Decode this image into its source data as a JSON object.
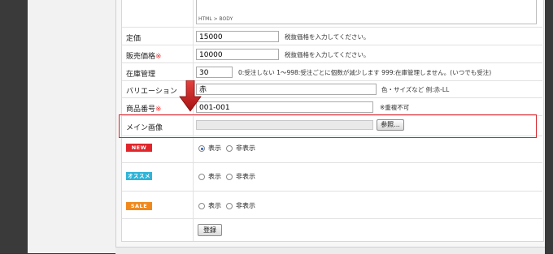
{
  "editor": {
    "path": "HTML > BODY"
  },
  "fields": {
    "price": {
      "label": "定価",
      "value": "15000",
      "hint": "税抜価格を入力してください。"
    },
    "sale_price": {
      "label": "販売価格",
      "req": "※",
      "value": "10000",
      "hint": "税抜価格を入力してください。"
    },
    "stock": {
      "label": "在庫管理",
      "value": "30",
      "hint": "0:受注しない  1〜998:受注ごとに個数が減少します  999:在庫管理しません。(いつでも受注)"
    },
    "variation": {
      "label": "バリエーション",
      "value": "赤",
      "hint": "色・サイズなど  例:赤-LL"
    },
    "product_no": {
      "label": "商品番号",
      "req": "※",
      "value": "001-001",
      "hint": "※重複不可"
    },
    "main_image": {
      "label": "メイン画像",
      "browse": "参照..."
    }
  },
  "badges": [
    {
      "text": "NEW",
      "color": "#e0262b",
      "options": [
        "表示",
        "非表示"
      ],
      "selected": 0
    },
    {
      "text": "オススメ",
      "color": "#2fb4d8",
      "options": [
        "表示",
        "非表示"
      ],
      "selected": -1
    },
    {
      "text": "SALE",
      "color": "#f0891d",
      "options": [
        "表示",
        "非表示"
      ],
      "selected": -1
    }
  ],
  "submit": "登録",
  "colors": {
    "highlight": "#d8282e",
    "arrow": "#c41a1a"
  }
}
